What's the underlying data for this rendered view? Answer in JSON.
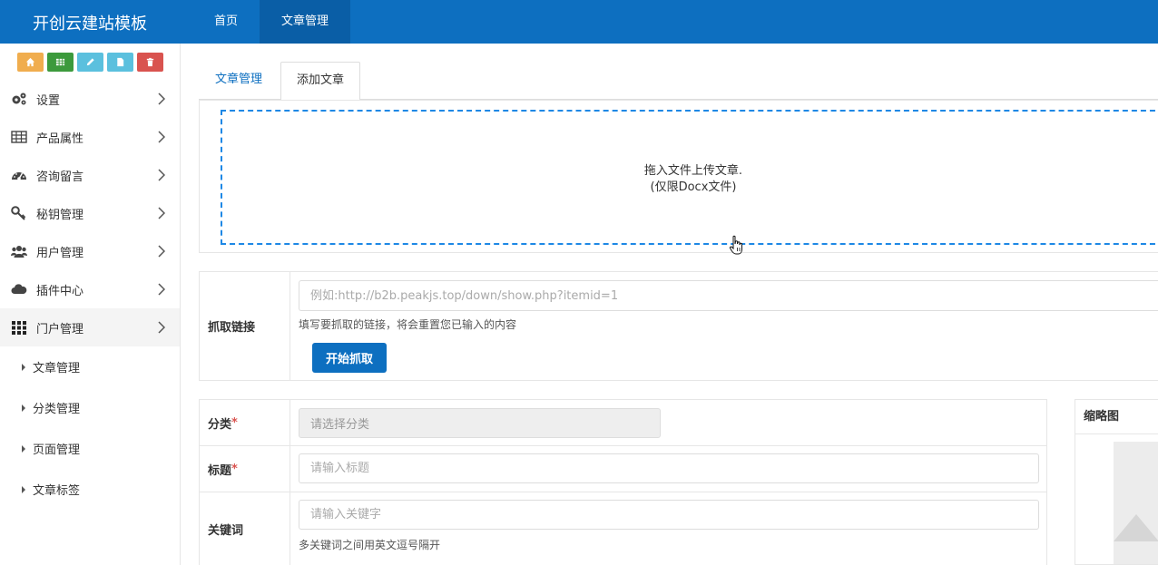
{
  "app": {
    "brand": "开创云建站模板"
  },
  "topnav": [
    {
      "label": "首页",
      "active": false
    },
    {
      "label": "文章管理",
      "active": true
    }
  ],
  "quickbar": [
    {
      "name": "home-icon",
      "color": "#f0ad4e"
    },
    {
      "name": "grid-icon",
      "color": "#3c9a3c"
    },
    {
      "name": "pencil-icon",
      "color": "#5bc0de"
    },
    {
      "name": "file-icon",
      "color": "#5bc0de"
    },
    {
      "name": "trash-icon",
      "color": "#d9534f"
    }
  ],
  "sidebar": {
    "items": [
      {
        "label": "设置",
        "icon": "gears-icon"
      },
      {
        "label": "产品属性",
        "icon": "table-icon"
      },
      {
        "label": "咨询留言",
        "icon": "dashboard-icon"
      },
      {
        "label": "秘钥管理",
        "icon": "key-icon"
      },
      {
        "label": "用户管理",
        "icon": "users-icon"
      },
      {
        "label": "插件中心",
        "icon": "cloud-icon"
      },
      {
        "label": "门户管理",
        "icon": "apps-grid-icon"
      }
    ],
    "subitems": [
      {
        "label": "文章管理"
      },
      {
        "label": "分类管理"
      },
      {
        "label": "页面管理"
      },
      {
        "label": "文章标签"
      }
    ]
  },
  "tabs": [
    {
      "label": "文章管理"
    },
    {
      "label": "添加文章"
    }
  ],
  "upload": {
    "line1": "拖入文件上传文章.",
    "line2": "(仅限Docx文件)"
  },
  "fetch": {
    "label": "抓取链接",
    "placeholder": "例如:http://b2b.peakjs.top/down/show.php?itemid=1",
    "help": "填写要抓取的链接，将会重置您已输入的内容",
    "button": "开始抓取"
  },
  "form": {
    "category": {
      "label": "分类",
      "required_mark": "*",
      "placeholder": "请选择分类"
    },
    "title": {
      "label": "标题",
      "required_mark": "*",
      "placeholder": "请输入标题"
    },
    "keywords": {
      "label": "关键词",
      "placeholder": "请输入关键字",
      "help": "多关键词之间用英文逗号隔开"
    }
  },
  "thumb": {
    "label": "缩略图"
  },
  "colors": {
    "primary": "#0d6fc0",
    "primary_dark": "#0a5ea6",
    "dashed": "#1e88e5",
    "required": "#d9534f"
  }
}
